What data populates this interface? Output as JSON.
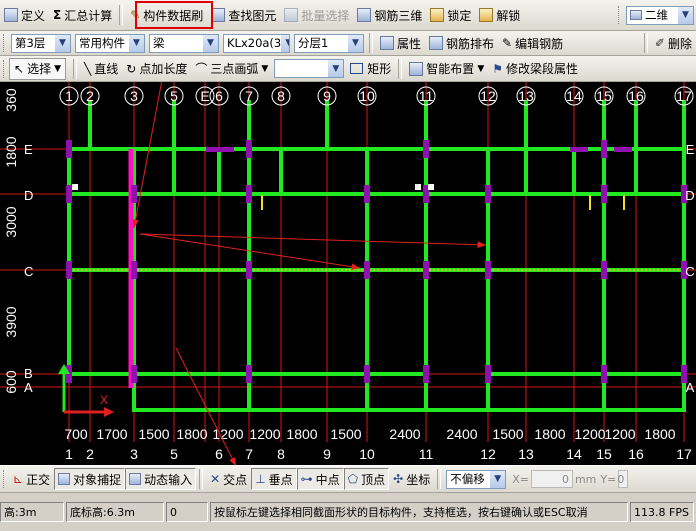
{
  "toolbar1": {
    "define": "定义",
    "sum_calc": "汇总计算",
    "brush": "构件数据刷",
    "find": "查找图元",
    "batch_select": "批量选择",
    "rebar_3d": "钢筋三维",
    "lock": "锁定",
    "unlock": "解锁",
    "view_mode": "二维"
  },
  "toolbar2": {
    "floor": "第3层",
    "comp_group": "常用构件",
    "comp_type": "梁",
    "comp_name": "KLx20a(3",
    "layer": "分层1",
    "property": "属性",
    "rebar_layout": "钢筋排布",
    "edit_rebar": "编辑钢筋",
    "delete": "删除"
  },
  "toolbar3": {
    "select": "选择",
    "line": "直线",
    "point_len": "点加长度",
    "three_arc": "三点画弧",
    "blank_combo": "",
    "rect": "矩形",
    "smart_layout": "智能布置",
    "modify_seg": "修改梁段属性"
  },
  "cad": {
    "top_axes": [
      "1",
      "2",
      "3",
      "5",
      "E",
      "6",
      "7",
      "8",
      "9",
      "10",
      "11",
      "12",
      "13",
      "14",
      "15",
      "16",
      "17"
    ],
    "bottom_axes": [
      "1",
      "2",
      "3",
      "5",
      "6",
      "7",
      "8",
      "9",
      "10",
      "11",
      "12",
      "13",
      "14",
      "15",
      "16",
      "17"
    ],
    "bottom_dims": [
      "700",
      "1700",
      "1500",
      "1800",
      "1200",
      "1200",
      "1800",
      "1500",
      "2400",
      "2400",
      "1500",
      "1800",
      "1200",
      "1200",
      "1800"
    ],
    "left_dims": [
      "360",
      "1800",
      "3000",
      "3900",
      "600"
    ],
    "row_labels_left": [
      "E",
      "D",
      "C",
      "B",
      "A"
    ],
    "row_labels_right": [
      "E",
      "D",
      "C",
      "A"
    ],
    "ucs_x": "X",
    "colors": {
      "grid": "#d01818",
      "beam": "#22e822",
      "column": "#9010b0",
      "selected": "#ff10c0",
      "axis_text": "#ffffff",
      "arrow": "#e02020",
      "highlight": "#e00000"
    }
  },
  "status1": {
    "ortho": "正交",
    "snap": "对象捕捉",
    "dyn_input": "动态输入",
    "intersect": "交点",
    "perp": "垂点",
    "mid": "中点",
    "vertex": "顶点",
    "coord": "坐标",
    "offset": "不偏移",
    "x_label": "X=",
    "x_val": "0",
    "mm": "mm",
    "y_label": "Y=",
    "y_val": "0"
  },
  "status2": {
    "floor_height": "高:3m",
    "base_height": "底标高:6.3m",
    "count": "0",
    "hint": "按鼠标左键选择相同截面形状的目标构件，支持框选，按右键确认或ESC取消",
    "fps": "113.8 FPS"
  }
}
